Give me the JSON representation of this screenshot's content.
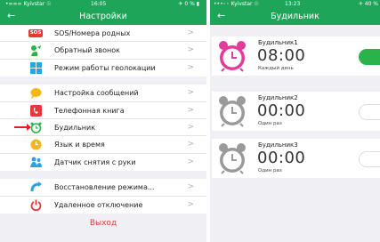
{
  "left": {
    "status": {
      "carrier": "•∞∞∞ Kyivstar ☉",
      "time": "16:05",
      "battery": "✈ 0 % ▮"
    },
    "title": "Настройки",
    "back": "←",
    "groups": [
      [
        {
          "label": "SOS/Номера родных",
          "badge": "SOS"
        },
        {
          "label": "Обратный звонок"
        },
        {
          "label": "Режим работы геолокации"
        }
      ],
      [
        {
          "label": "Настройка сообщений"
        },
        {
          "label": "Телефонная книга"
        },
        {
          "label": "Будильник"
        },
        {
          "label": "Язык и время"
        },
        {
          "label": "Датчик снятия с руки"
        }
      ],
      [
        {
          "label": "Восстановление режима..."
        },
        {
          "label": "Удаленное отключение"
        }
      ]
    ],
    "chevron": ">",
    "logout": "Выход"
  },
  "right": {
    "status": {
      "carrier": "•••◦◦ Kyivstar ☉",
      "time": "13:23",
      "battery": "✈ 40 %"
    },
    "title": "Будильник",
    "back": "←",
    "alarms": [
      {
        "name": "Будильник1",
        "time": "08:00",
        "repeat": "Каждый день",
        "enabled": true
      },
      {
        "name": "Будильник2",
        "time": "00:00",
        "repeat": "Один раз",
        "enabled": false
      },
      {
        "name": "Будильник3",
        "time": "00:00",
        "repeat": "Один раз",
        "enabled": false
      }
    ]
  },
  "colors": {
    "accent": "#1ea55a",
    "toggle_on": "#2bb34b",
    "alarm_pink": "#e6399b",
    "alarm_gray": "#9a9a9a"
  },
  "icons": [
    "sos-badge",
    "callback-icon",
    "geolocation-icon",
    "message-icon",
    "phonebook-icon",
    "alarm-clock-icon",
    "language-time-icon",
    "wrist-sensor-icon",
    "restore-icon",
    "power-icon"
  ]
}
